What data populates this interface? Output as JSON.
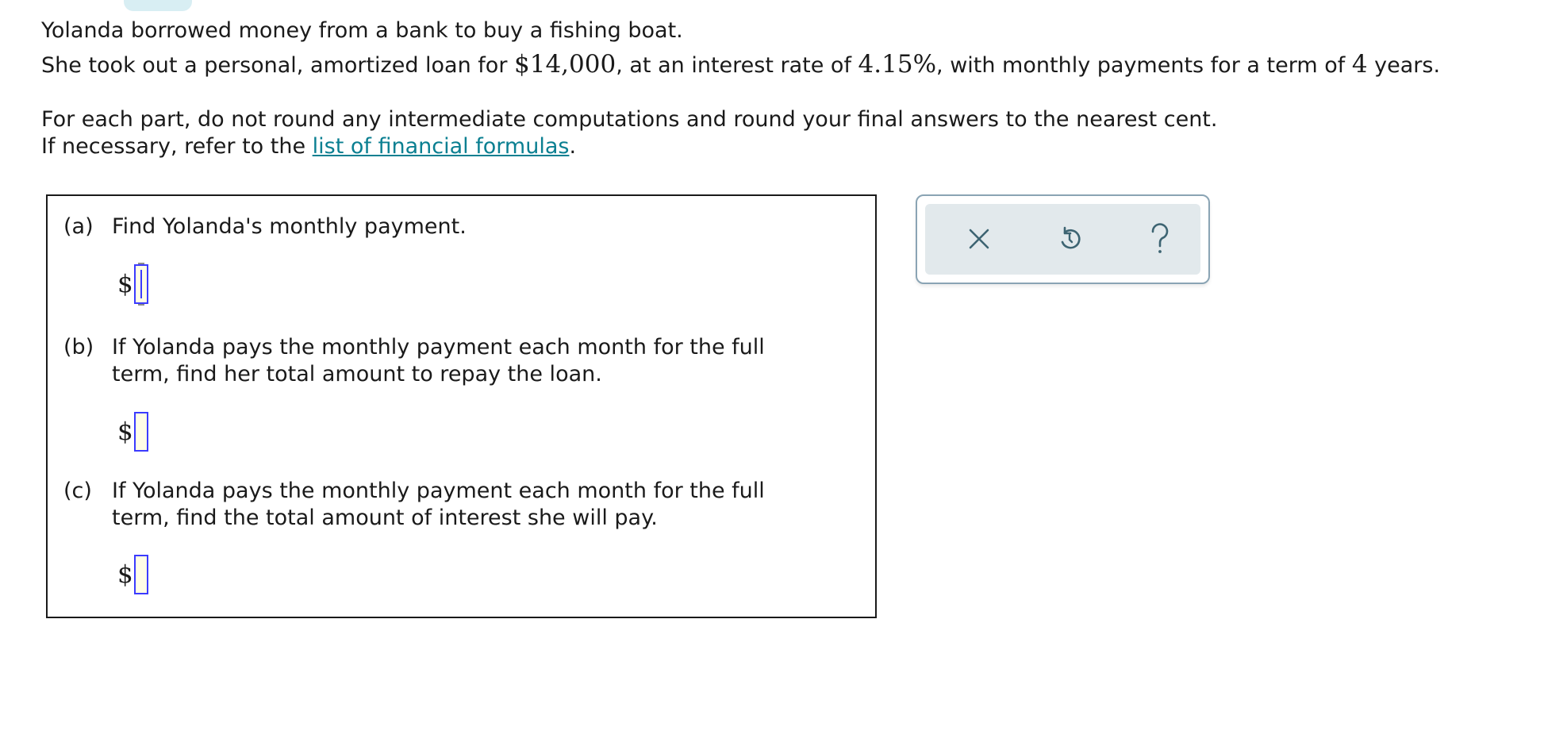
{
  "problem": {
    "line1": "Yolanda borrowed money from a bank to buy a fishing boat.",
    "line2_pre": "She took out a personal, amortized loan for ",
    "loan_amount": "$14,000",
    "line2_mid": ", at an interest rate of ",
    "rate": "4.15%",
    "line2_mid2": ", with monthly payments for a term of ",
    "term": "4",
    "line2_post": " years."
  },
  "instructions": {
    "line1": "For each part, do not round any intermediate computations and round your final answers to the nearest cent.",
    "line2_pre": "If necessary, refer to the ",
    "link_text": "list of financial formulas",
    "line2_post": "."
  },
  "parts": [
    {
      "letter": "(a)",
      "text": "Find Yolanda's monthly payment.",
      "currency": "$",
      "value": ""
    },
    {
      "letter": "(b)",
      "text": "If Yolanda pays the monthly payment each month for the full term, find her total amount to repay the loan.",
      "currency": "$",
      "value": ""
    },
    {
      "letter": "(c)",
      "text": "If Yolanda pays the monthly payment each month for the full term, find the total amount of interest she will pay.",
      "currency": "$",
      "value": ""
    }
  ],
  "toolbar": {
    "buttons": [
      {
        "icon": "close-icon",
        "color": "#3d6472"
      },
      {
        "icon": "undo-icon",
        "color": "#3d6472"
      },
      {
        "icon": "help-icon",
        "color": "#3d6472"
      }
    ]
  },
  "colors": {
    "link": "#0a7f91",
    "input_border": "#3b3bff",
    "input_fill": "#fffde6",
    "toolbar_bg": "#e2e9ec",
    "toolbar_border": "#8aa4b4"
  }
}
